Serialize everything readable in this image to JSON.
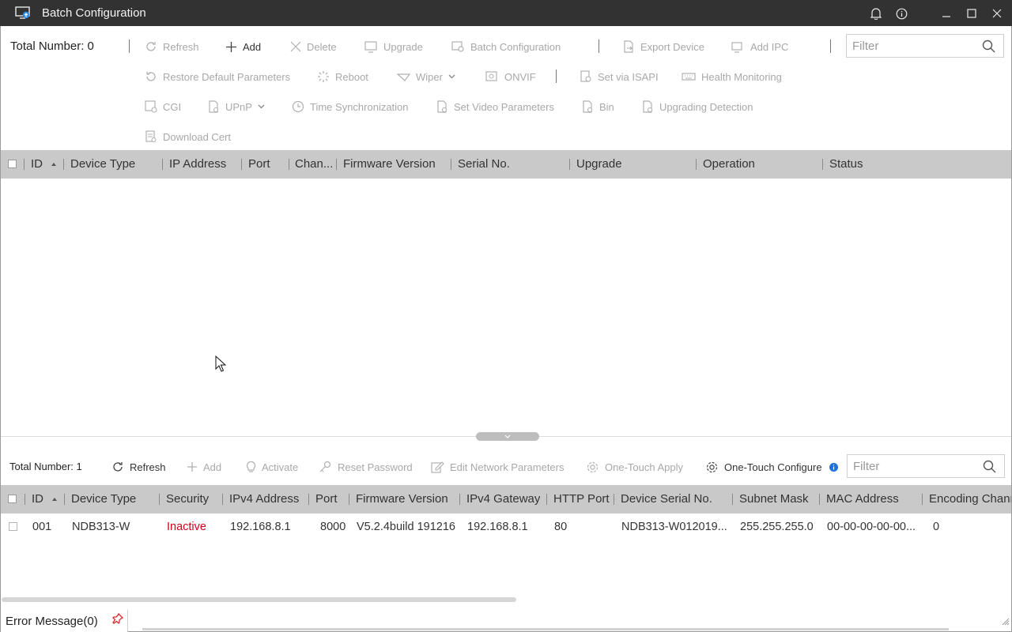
{
  "window": {
    "title": "Batch Configuration"
  },
  "top_panel": {
    "total": "Total Number: 0",
    "filter_placeholder": "Filter",
    "toolbar": {
      "refresh": "Refresh",
      "add": "Add",
      "delete": "Delete",
      "upgrade": "Upgrade",
      "batch_configuration": "Batch Configuration",
      "export_device": "Export Device",
      "add_ipc": "Add IPC",
      "restore_default": "Restore Default Parameters",
      "reboot": "Reboot",
      "wiper": "Wiper",
      "onvif": "ONVIF",
      "set_via_isapi": "Set via ISAPI",
      "health_monitoring": "Health Monitoring",
      "cgi": "CGI",
      "upnp": "UPnP",
      "time_sync": "Time Synchronization",
      "set_video_params": "Set Video Parameters",
      "bin": "Bin",
      "upgrading_detection": "Upgrading Detection",
      "download_cert": "Download Cert"
    },
    "columns": [
      "ID",
      "Device Type",
      "IP Address",
      "Port",
      "Chan...",
      "Firmware Version",
      "Serial No.",
      "Upgrade",
      "Operation",
      "Status"
    ]
  },
  "bottom_panel": {
    "total": "Total Number: 1",
    "filter_placeholder": "Filter",
    "toolbar": {
      "refresh": "Refresh",
      "add": "Add",
      "activate": "Activate",
      "reset_password": "Reset Password",
      "edit_network": "Edit Network Parameters",
      "one_touch_apply": "One-Touch Apply",
      "one_touch_configure": "One-Touch Configure"
    },
    "columns": [
      "ID",
      "Device Type",
      "Security",
      "IPv4 Address",
      "Port",
      "Firmware Version",
      "IPv4 Gateway",
      "HTTP Port",
      "Device Serial No.",
      "Subnet Mask",
      "MAC Address",
      "Encoding Chann"
    ],
    "rows": [
      {
        "id": "001",
        "device_type": "NDB313-W",
        "security": "Inactive",
        "ipv4": "192.168.8.1",
        "port": "8000",
        "firmware": "V5.2.4build 191216",
        "gateway": "192.168.8.1",
        "http_port": "80",
        "serial": "NDB313-W012019...",
        "subnet": "255.255.255.0",
        "mac": "00-00-00-00-00...",
        "encoding": "0"
      }
    ]
  },
  "footer": {
    "error_tab": "Error Message(0)"
  },
  "colors": {
    "titlebar": "#323232",
    "header_bg": "#c9c9c9",
    "inactive": "#d0021b",
    "info_dot": "#1e73d8",
    "pin": "#e0262b"
  },
  "icons": [
    "monitor-upload-icon",
    "bell-icon",
    "info-icon",
    "minimize-icon",
    "maximize-icon",
    "close-icon",
    "search-icon",
    "pin-icon",
    "cursor-arrow-icon"
  ]
}
